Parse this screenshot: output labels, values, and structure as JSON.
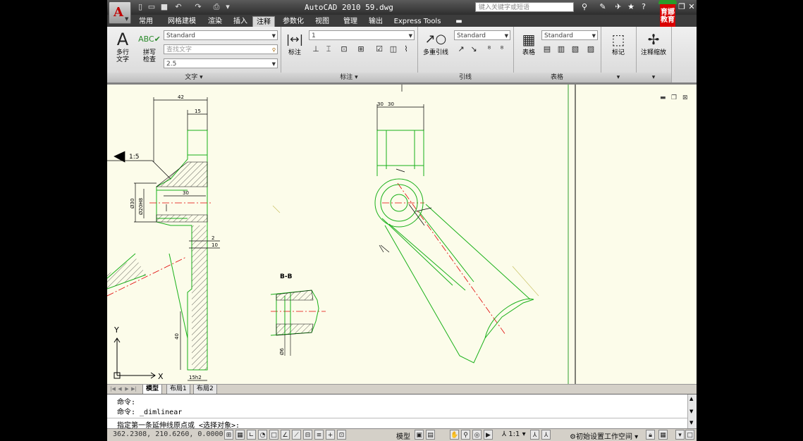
{
  "window": {
    "title": "AutoCAD 2010   59.dwg",
    "search_placeholder": "键入关键字或短语",
    "brand_text": "育娜教育"
  },
  "app_button": {
    "letter": "A"
  },
  "tabs": [
    "常用",
    "网格建模",
    "渲染",
    "插入",
    "注释",
    "参数化",
    "视图",
    "管理",
    "输出",
    "Express Tools"
  ],
  "active_tab": "注释",
  "ribbon": {
    "text_panel": {
      "title": "文字",
      "multiline_text": "多行\n文字",
      "spell_check": "拼写\n检查",
      "style_combo": "Standard",
      "find_placeholder": "查找文字",
      "height_combo": "2.5"
    },
    "dim_panel": {
      "title": "标注",
      "button": "标注",
      "style_combo": "1"
    },
    "leader_panel": {
      "title": "引线",
      "button": "多重引线",
      "style_combo": "Standard"
    },
    "table_panel": {
      "title": "表格",
      "button": "表格",
      "style_combo": "Standard"
    },
    "markup_panel": {
      "button": "标记"
    },
    "annoscale_panel": {
      "button": "注释缩放"
    }
  },
  "drawing": {
    "dims": [
      "42",
      "15",
      "30",
      "30",
      "2",
      "10",
      "40",
      "15h2",
      "Ø30",
      "Ø20H8",
      "1:5",
      "B-B",
      "Ø6",
      "30"
    ],
    "ucs": {
      "y": "Y",
      "x": "X"
    }
  },
  "layout_tabs": [
    "模型",
    "布局1",
    "布局2"
  ],
  "active_layout": "模型",
  "command": {
    "lines": [
      "命令:",
      "命令: _dimlinear"
    ],
    "prompt": "指定第一条延伸线原点或 <选择对象>:"
  },
  "status": {
    "coords": "362.2308, 210.6260, 0.0000",
    "space_label": "模型",
    "scale": "1:1",
    "workspace": "初始设置工作空间"
  }
}
